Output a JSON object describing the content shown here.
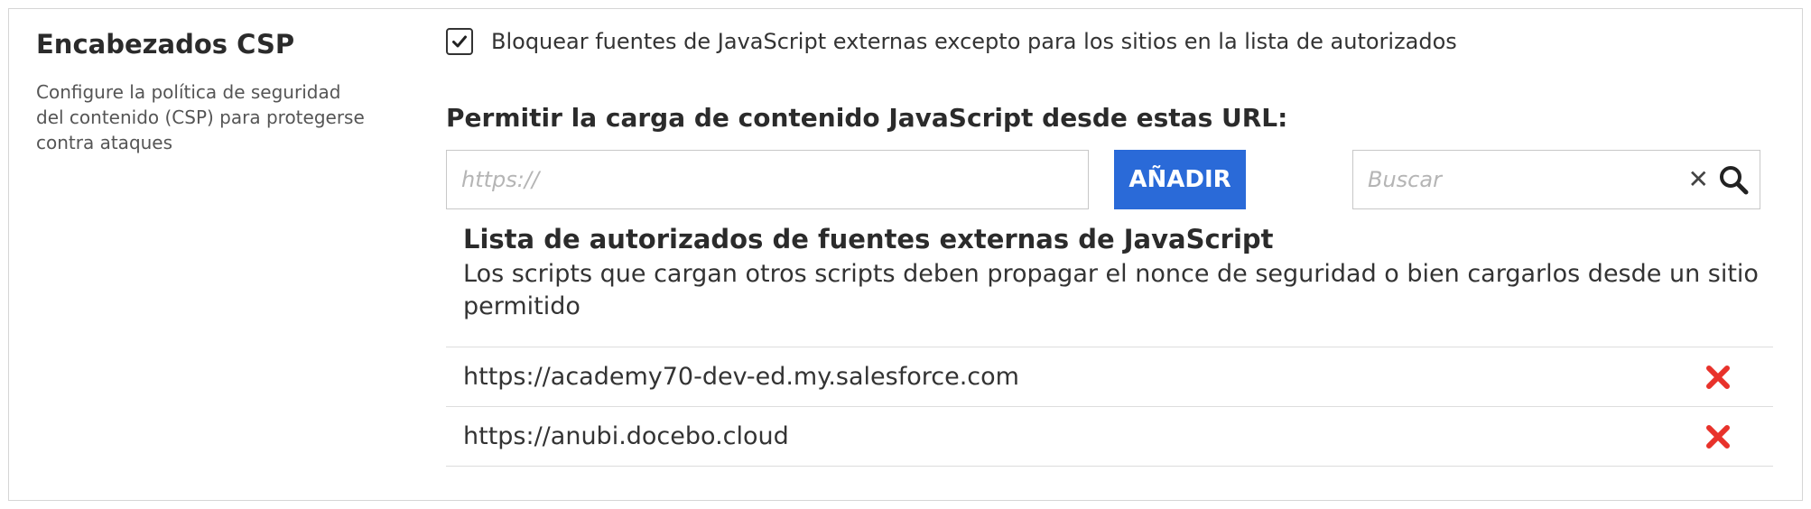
{
  "section": {
    "title": "Encabezados CSP",
    "description": "Configure la política de seguridad del contenido (CSP) para protegerse contra ataques"
  },
  "block_option": {
    "checked": true,
    "label": "Bloquear fuentes de JavaScript externas excepto para los sitios en la lista de autorizados"
  },
  "allow": {
    "title": "Permitir la carga de contenido JavaScript desde estas URL:",
    "url_placeholder": "https://",
    "url_value": "",
    "add_label": "AÑADIR"
  },
  "search": {
    "placeholder": "Buscar",
    "value": ""
  },
  "whitelist": {
    "title": "Lista de autorizados de fuentes externas de JavaScript",
    "description": "Los scripts que cargan otros scripts deben propagar el nonce de seguridad o bien cargarlos desde un sitio permitido",
    "items": [
      {
        "url": "https://academy70-dev-ed.my.salesforce.com"
      },
      {
        "url": "https://anubi.docebo.cloud"
      }
    ]
  },
  "icons": {
    "checkbox": "checkmark-icon",
    "clear": "close-icon",
    "search": "search-icon",
    "delete": "delete-x-icon"
  },
  "colors": {
    "accent": "#2a6ad8",
    "delete": "#e8322b",
    "border": "#d6d6d6"
  }
}
